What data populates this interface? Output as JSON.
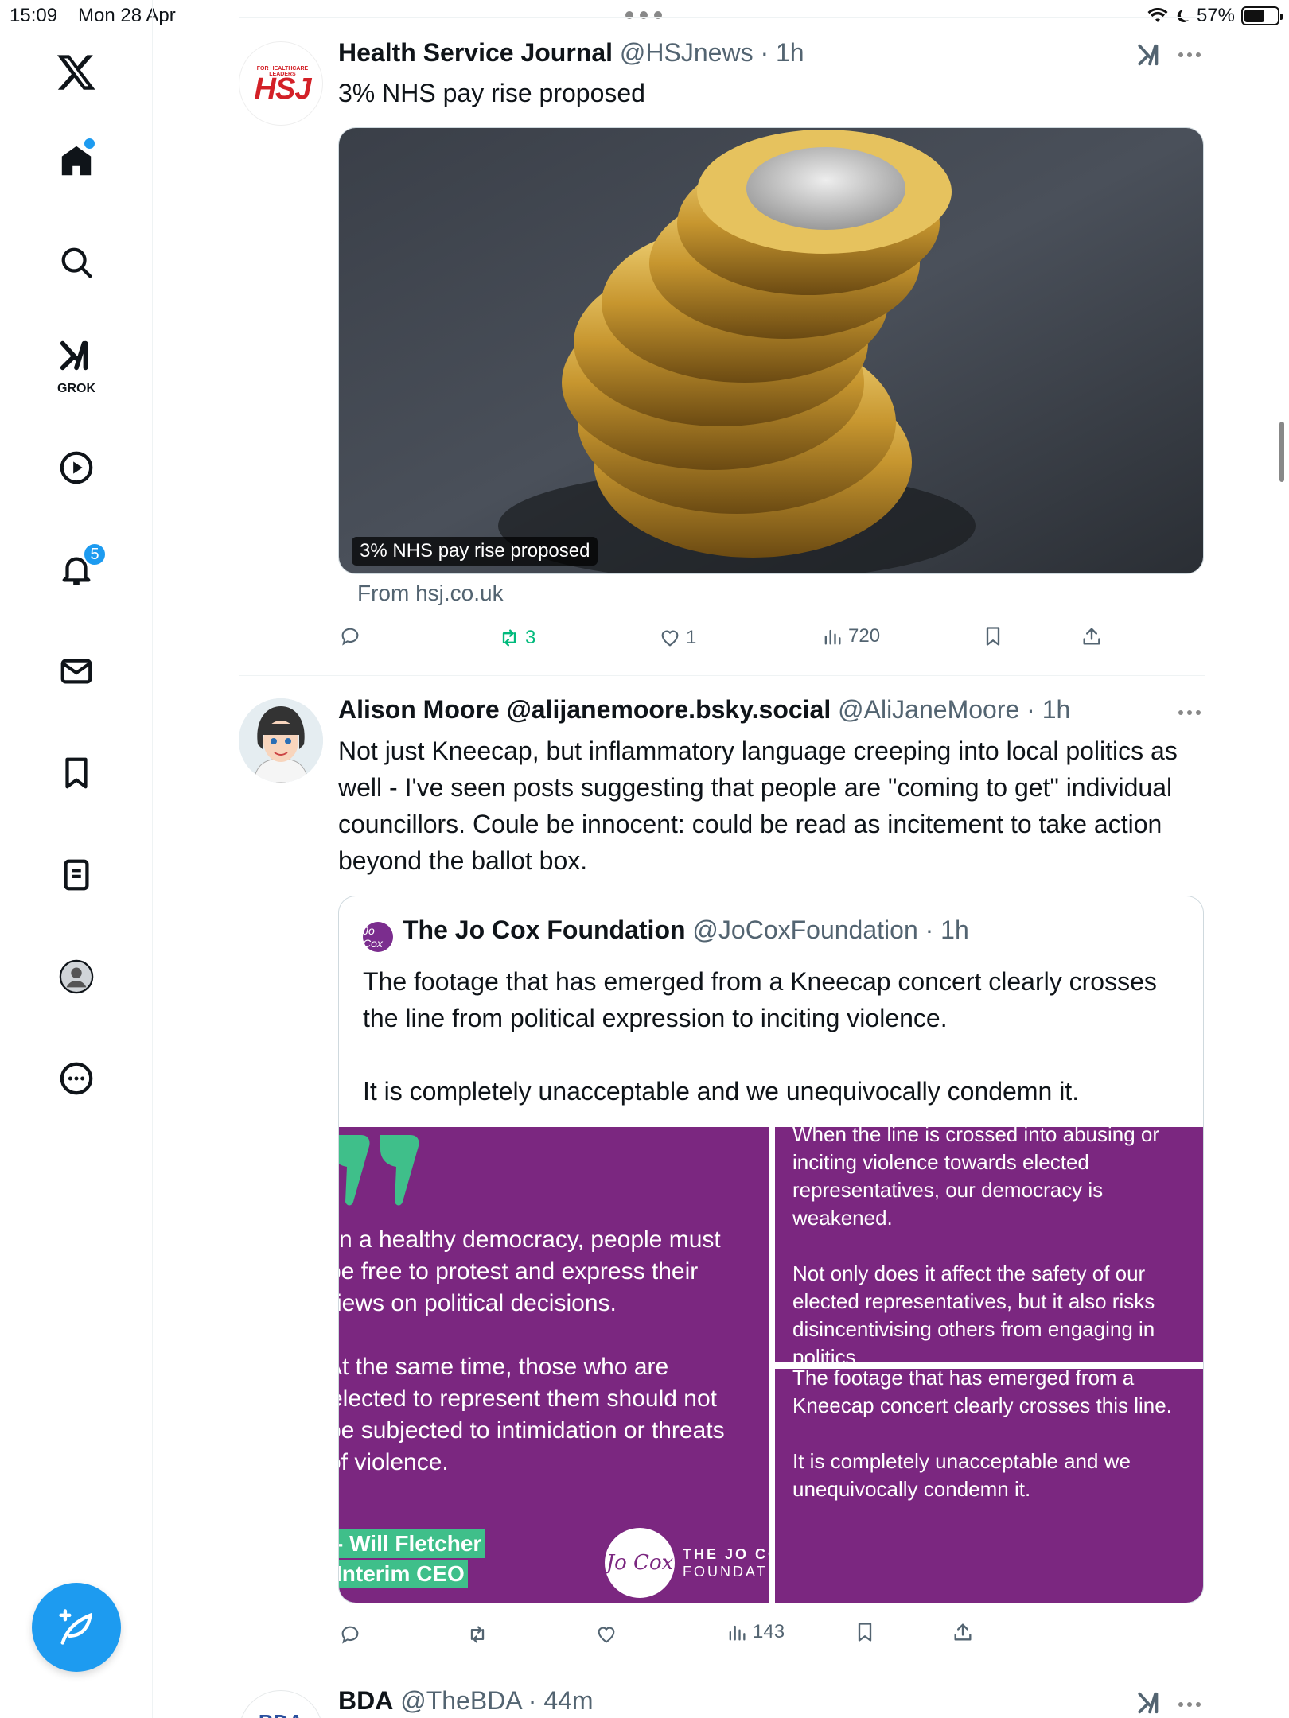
{
  "status_bar": {
    "time": "15:09",
    "date": "Mon 28 Apr",
    "battery": "57%",
    "battery_level": 0.57
  },
  "sidebar": {
    "grok_label": "GROK",
    "notifications_badge": "5",
    "items": [
      "x-logo",
      "home",
      "search",
      "grok",
      "video",
      "notifications",
      "messages",
      "bookmarks",
      "lists",
      "profile",
      "more"
    ]
  },
  "colors": {
    "accent": "#1d9bf0",
    "retweet_green": "#00ba7c",
    "jocox_purple": "#7b2780",
    "jocox_green": "#3fbf8a",
    "hsj_red": "#d32027"
  },
  "tweets": [
    {
      "name": "Health Service Journal",
      "handle": "@HSJnews",
      "time": "1h",
      "avatar_text": "HSJ",
      "avatar_small": "FOR HEALTHCARE LEADERS",
      "text": "3% NHS pay rise proposed",
      "card": {
        "image_label": "3% NHS pay rise proposed",
        "source": "From hsj.co.uk"
      },
      "stats": {
        "replies": "",
        "retweets": "3",
        "likes": "1",
        "views": "720"
      }
    },
    {
      "name": "Alison Moore @alijanemoore.bsky.social",
      "handle": "@AliJaneMoore",
      "time": "1h",
      "text": "Not just Kneecap, but inflammatory language creeping into local politics as well - I've seen posts suggesting that people are \"coming to get\" individual councillors. Coule be innocent: could be read as incitement to take action beyond the ballot box.",
      "quote": {
        "name": "The Jo Cox Foundation",
        "handle": "@JoCoxFoundation",
        "time": "1h",
        "avatar_text": "Jo Cox",
        "text1": "The footage that has emerged from a Kneecap concert clearly crosses the line from political expression to inciting violence.",
        "text2": "It is completely unacceptable and we unequivocally condemn it.",
        "images": {
          "a_p1": "n a healthy democracy, people must be free to protest and express their views on political decisions.",
          "a_l1": "n a healthy democracy, people must",
          "a_l2": "be free to protest and express their",
          "a_l3": "views on political decisions.",
          "a_l4": "At the same time, those who are",
          "a_l5": "elected to represent them should not",
          "a_l6": "be subjected to intimidation or threats",
          "a_l7": "of violence.",
          "a_tag1": "- Will Fletcher",
          "a_tag2": "Interim CEO",
          "logo_text": "Jo Cox",
          "brand1": "THE JO COX",
          "brand2": "FOUNDATION",
          "b_p1": "When the line is crossed into abusing or inciting violence towards elected representatives, our democracy is weakened.",
          "b_p2": "Not only does it affect the safety of our elected representatives, but it also risks disincentivising others from engaging in politics.",
          "c_p1": "The footage that has emerged from a Kneecap concert clearly crosses this line.",
          "c_p2": "It is completely unacceptable and we unequivocally condemn it."
        }
      },
      "stats": {
        "replies": "",
        "retweets": "",
        "likes": "",
        "views": "143"
      }
    },
    {
      "name": "BDA",
      "handle": "@TheBDA",
      "time": "44m",
      "avatar_text": "BDA"
    }
  ]
}
